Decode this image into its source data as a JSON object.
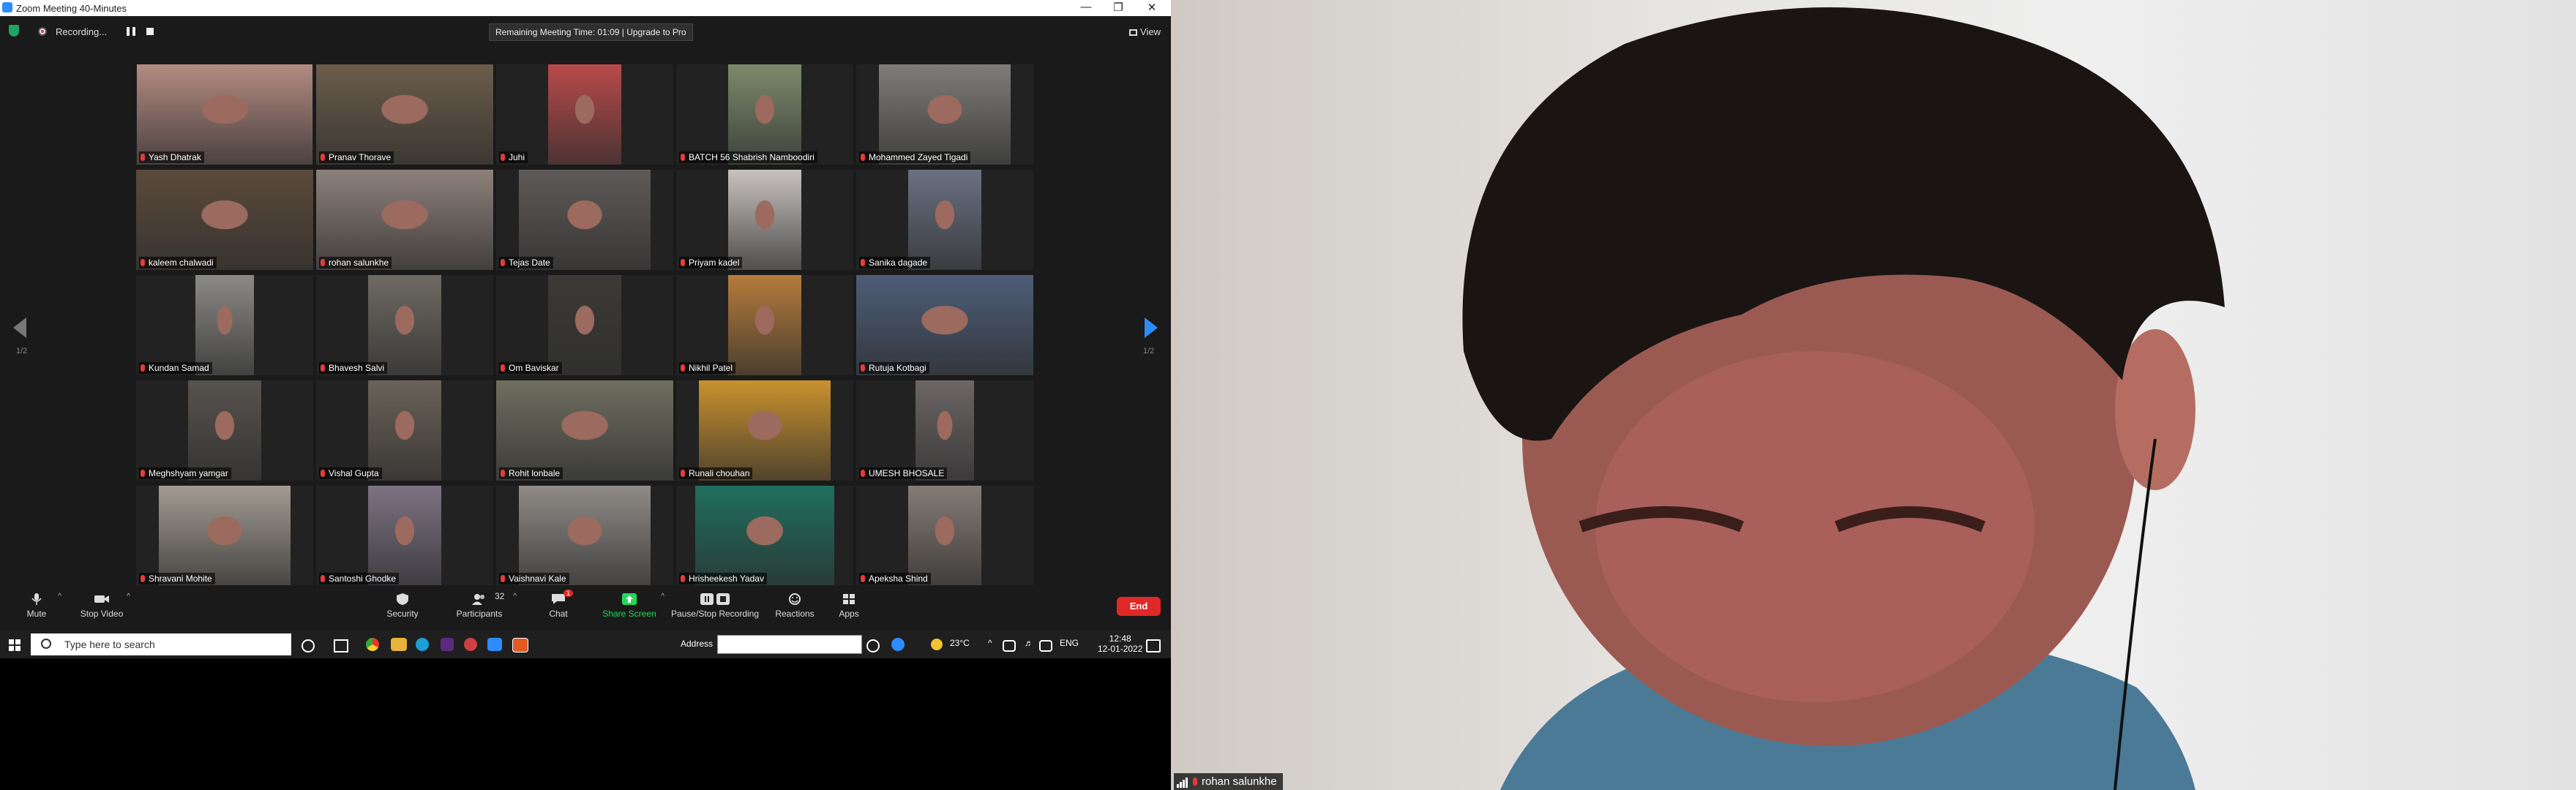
{
  "window": {
    "title": "Zoom Meeting 40-Minutes"
  },
  "topbar": {
    "recording_label": "Recording...",
    "remaining_text": "Remaining Meeting Time: 01:09 | Upgrade to Pro",
    "view_label": "View"
  },
  "gallery": {
    "page_left": "1/2",
    "page_right": "1/2",
    "participants": [
      {
        "name": "Yash Dhatrak",
        "color": "#b38b82"
      },
      {
        "name": "Pranav Thorave",
        "color": "#6b5d4b"
      },
      {
        "name": "Juhi",
        "color": "#b94a4a"
      },
      {
        "name": "BATCH 56 Shabrish Namboodiri",
        "color": "#7c8a6c"
      },
      {
        "name": "Mohammed Zayed Tigadi",
        "color": "#7e7d7a"
      },
      {
        "name": "kaleem chalwadi",
        "color": "#5b4a3b"
      },
      {
        "name": "rohan salunkhe",
        "color": "#8d807a"
      },
      {
        "name": "Tejas Date",
        "color": "#5e5a58"
      },
      {
        "name": "Priyam kadel",
        "color": "#c7c2bf"
      },
      {
        "name": "Sanika dagade",
        "color": "#6a7182"
      },
      {
        "name": "Kundan Samad",
        "color": "#8b8a88"
      },
      {
        "name": "Bhavesh Salvi",
        "color": "#6e6a63"
      },
      {
        "name": "Om Baviskar",
        "color": "#3b3a37"
      },
      {
        "name": "Nikhil Patel",
        "color": "#b57c3b"
      },
      {
        "name": "Rutuja Kotbagi",
        "color": "#4d5d78"
      },
      {
        "name": "Meghshyam yamgar",
        "color": "#56524e"
      },
      {
        "name": "Vishal Gupta",
        "color": "#6a6258"
      },
      {
        "name": "Rohit lonbale",
        "color": "#6f6e60"
      },
      {
        "name": "Runali chouhan",
        "color": "#c9912f"
      },
      {
        "name": "UMESH BHOSALE",
        "color": "#6c6666"
      },
      {
        "name": "Shravani Mohite",
        "color": "#a29b92"
      },
      {
        "name": "Santoshi Ghodke",
        "color": "#7c7383"
      },
      {
        "name": "Vaishnavi Kale",
        "color": "#8f8b87"
      },
      {
        "name": "Hrisheekesh Yadav",
        "color": "#1f6f5e"
      },
      {
        "name": "Apeksha Shind",
        "color": "#857b75"
      }
    ]
  },
  "toolbar": {
    "mute": "Mute",
    "stop_video": "Stop Video",
    "security": "Security",
    "participants": "Participants",
    "participants_count": "32",
    "chat": "Chat",
    "chat_badge": "1",
    "share_screen": "Share Screen",
    "pause_stop": "Pause/Stop Recording",
    "reactions": "Reactions",
    "apps": "Apps",
    "end": "End"
  },
  "taskbar": {
    "search_placeholder": "Type here to search",
    "address_label": "Address",
    "temperature": "23°C",
    "language": "ENG",
    "time": "12:48",
    "date": "12-01-2022"
  },
  "speaker": {
    "name": "rohan salunkhe"
  }
}
